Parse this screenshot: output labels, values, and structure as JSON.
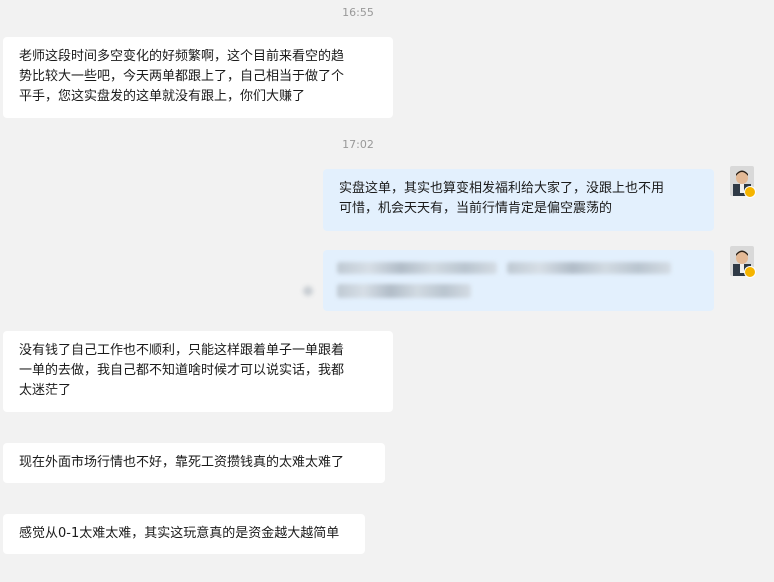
{
  "colors": {
    "background": "#f2f2f2",
    "incoming_bubble": "#ffffff",
    "outgoing_bubble": "#e3f0fd",
    "timestamp": "#999999",
    "badge": "#f5b400"
  },
  "timestamps": [
    "16:55",
    "17:02"
  ],
  "messages": [
    {
      "direction": "incoming",
      "lines": [
        "老师这段时间多空变化的好频繁啊，这个目前来看空的趋",
        "势比较大一些吧，今天两单都跟上了，自己相当于做了个",
        "平手，您这实盘发的这单就没有跟上，你们大赚了"
      ]
    },
    {
      "direction": "outgoing",
      "lines": [
        "实盘这单，其实也算变相发福利给大家了，没跟上也不用",
        "可惜，机会天天有，当前行情肯定是偏空震荡的"
      ]
    },
    {
      "direction": "outgoing",
      "content": "blurred-image"
    },
    {
      "direction": "incoming",
      "lines": [
        "没有钱了自己工作也不顺利，只能这样跟着单子一单跟着",
        "一单的去做，我自己都不知道啥时候才可以说实话，我都",
        "太迷茫了"
      ]
    },
    {
      "direction": "incoming",
      "lines": [
        "现在外面市场行情也不好，靠死工资攒钱真的太难太难了"
      ]
    },
    {
      "direction": "incoming",
      "lines": [
        "感觉从0-1太难太难，其实这玩意真的是资金越大越简单"
      ]
    }
  ],
  "icons": {
    "avatar": "user-avatar-icon",
    "badge": "verified-badge-icon"
  }
}
